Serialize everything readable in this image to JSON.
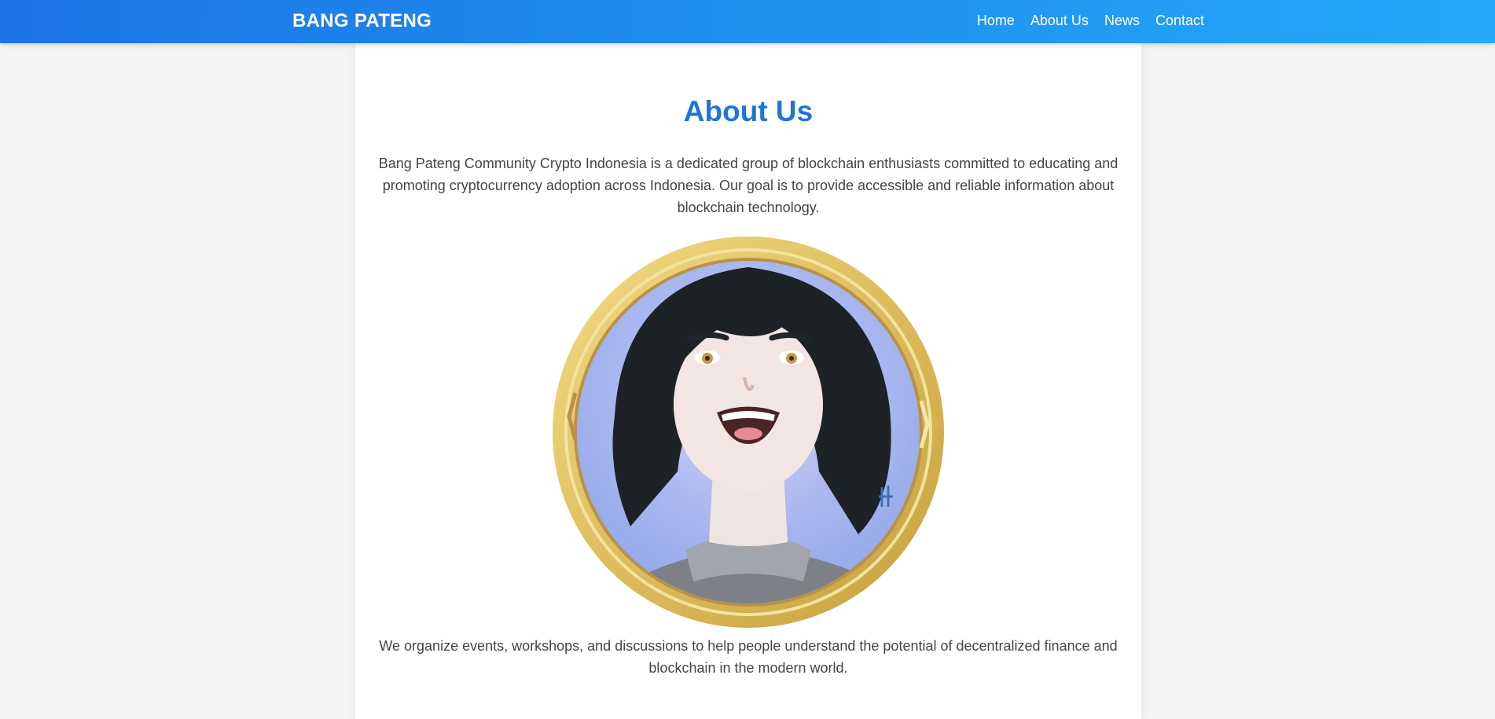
{
  "header": {
    "brand": "BANG PATENG",
    "nav": [
      {
        "label": "Home"
      },
      {
        "label": "About Us"
      },
      {
        "label": "News"
      },
      {
        "label": "Contact"
      }
    ]
  },
  "main": {
    "title": "About Us",
    "intro": "Bang Pateng Community Crypto Indonesia is a dedicated group of blockchain enthusiasts committed to educating and promoting cryptocurrency adoption across Indonesia. Our goal is to provide accessible and reliable information about blockchain technology.",
    "image_icon": "coin-avatar-icon",
    "outro": "We organize events, workshops, and discussions to help people understand the potential of decentralized finance and blockchain in the modern world."
  },
  "colors": {
    "nav_start": "#1c74e6",
    "nav_end": "#23a9f7",
    "title": "#1f74d8",
    "text": "#444444",
    "coin_gold": "#e2c46a"
  }
}
